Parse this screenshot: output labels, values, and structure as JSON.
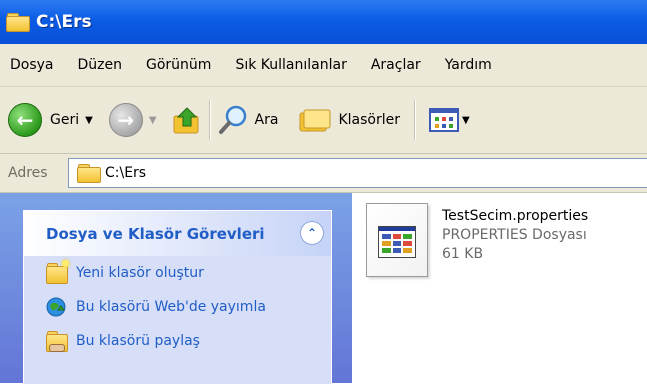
{
  "window": {
    "title": "C:\\Ers"
  },
  "menu": [
    "Dosya",
    "Düzen",
    "Görünüm",
    "Sık Kullanılanlar",
    "Araçlar",
    "Yardım"
  ],
  "toolbar": {
    "back_label": "Geri",
    "search_label": "Ara",
    "folders_label": "Klasörler"
  },
  "address": {
    "label": "Adres",
    "path": "C:\\Ers"
  },
  "tasks_panel": {
    "title": "Dosya ve Klasör Görevleri",
    "items": [
      {
        "label": "Yeni klasör oluştur",
        "icon": "new-folder-icon"
      },
      {
        "label": "Bu klasörü Web'de yayımla",
        "icon": "publish-web-icon"
      },
      {
        "label": "Bu klasörü paylaş",
        "icon": "share-folder-icon"
      }
    ]
  },
  "files": [
    {
      "name": "TestSecim.properties",
      "type": "PROPERTIES Dosyası",
      "size": "61 KB",
      "icon": "properties-file-icon"
    }
  ],
  "colors": {
    "titlebar": "#0b5ce6",
    "chrome": "#ece9d8",
    "task_link": "#215dc6",
    "left_pane": "#6f8fe0"
  }
}
